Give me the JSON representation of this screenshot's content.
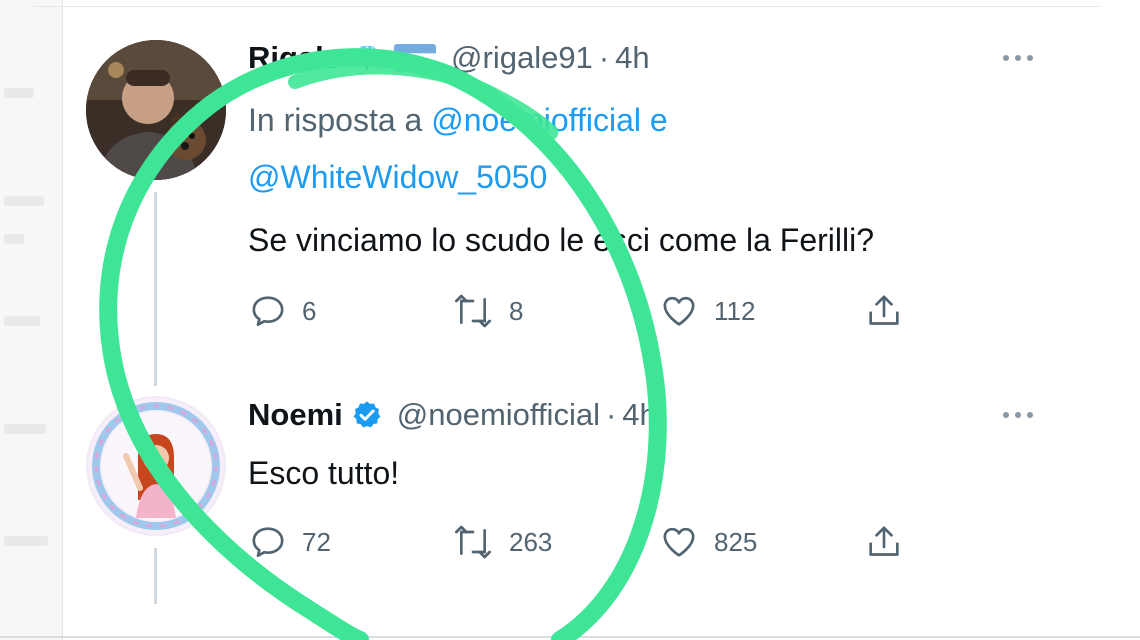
{
  "tweet_1": {
    "display_name": "Rigale",
    "badges": [
      "gem-emoji",
      "argentina-flag-emoji"
    ],
    "handle": "@rigale91",
    "separator": "·",
    "time": "4h",
    "reply_prefix": "In risposta a",
    "reply_mention_1": "@noemiofficial",
    "reply_conjunction": "e",
    "reply_mention_2": "@WhiteWidow_5050",
    "text": "Se vinciamo lo scudo le esci come la Ferilli?",
    "replies": "6",
    "retweets": "8",
    "likes": "112",
    "more_icon": "ellipsis-icon"
  },
  "tweet_2": {
    "display_name": "Noemi",
    "verified": true,
    "handle": "@noemiofficial",
    "separator": "·",
    "time": "4h",
    "text": "Esco tutto!",
    "replies": "72",
    "retweets": "263",
    "likes": "825",
    "more_icon": "ellipsis-icon"
  },
  "colors": {
    "text_primary": "#0f1419",
    "text_secondary": "#536471",
    "mention": "#1d9bf0",
    "verified": "#1d9bf0",
    "highlight_circle": "#3ee596"
  }
}
